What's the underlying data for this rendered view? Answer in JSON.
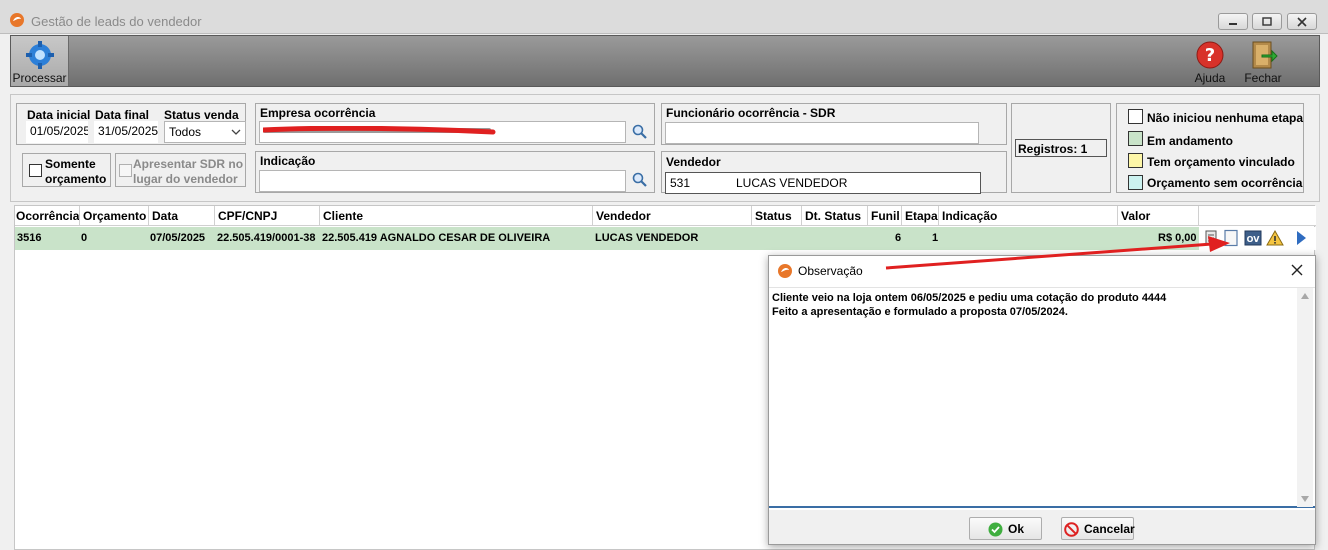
{
  "window": {
    "title": "Gestão de leads do vendedor"
  },
  "toolbar": {
    "processar_label": "Processar",
    "ajuda_label": "Ajuda",
    "fechar_label": "Fechar"
  },
  "filters": {
    "data_inicial_label": "Data inicial",
    "data_inicial_value": "01/05/2025",
    "data_final_label": "Data final",
    "data_final_value": "31/05/2025",
    "status_venda_label": "Status venda",
    "status_venda_value": "Todos",
    "somente_orcamento_label_1": "Somente",
    "somente_orcamento_label_2": "orçamento",
    "apresentar_sdr_label_1": "Apresentar SDR no",
    "apresentar_sdr_label_2": "lugar do vendedor",
    "empresa_label": "Empresa ocorrência",
    "indicacao_label": "Indicação",
    "indicacao_value": "",
    "funcionario_label": "Funcionário ocorrência - SDR",
    "funcionario_value": "",
    "vendedor_label": "Vendedor",
    "vendedor_code": "531",
    "vendedor_name": "LUCAS VENDEDOR",
    "registros_label": "Registros: 1"
  },
  "legend": {
    "items": [
      {
        "label": "Não iniciou nenhuma etapa",
        "color": "#ffffff"
      },
      {
        "label": "Em andamento",
        "color": "#c9e3c9"
      },
      {
        "label": "Tem orçamento vinculado",
        "color": "#fdf6a8"
      },
      {
        "label": "Orçamento sem ocorrência",
        "color": "#ccf2f0"
      }
    ]
  },
  "grid": {
    "columns": [
      "Ocorrência",
      "Orçamento",
      "Data",
      "CPF/CNPJ",
      "Cliente",
      "Vendedor",
      "Status",
      "Dt. Status",
      "Funil",
      "Etapa",
      "Indicação",
      "Valor"
    ],
    "rows": [
      {
        "ocorrencia": "3516",
        "orcamento": "0",
        "data": "07/05/2025",
        "cpf_cnpj": "22.505.419/0001-38",
        "cliente": "22.505.419 AGNALDO CESAR DE OLIVEIRA",
        "vendedor": "LUCAS VENDEDOR",
        "status": "",
        "dt_status": "",
        "funil": "6",
        "etapa": "1",
        "indicacao": "",
        "valor": "R$ 0,00"
      }
    ],
    "row_icon_ov": "OV"
  },
  "dialog": {
    "title": "Observação",
    "text_line_1": "Cliente veio na loja ontem 06/05/2025 e pediu uma cotação do produto 4444",
    "text_line_2": "Feito a apresentação e formulado a proposta 07/05/2024.",
    "ok_label": "Ok",
    "cancel_label": "Cancelar"
  },
  "colors": {
    "row_in_progress": "#c9e3c9",
    "annotation_arrow": "#e02020",
    "dialog_accent": "#3a6ea5"
  }
}
